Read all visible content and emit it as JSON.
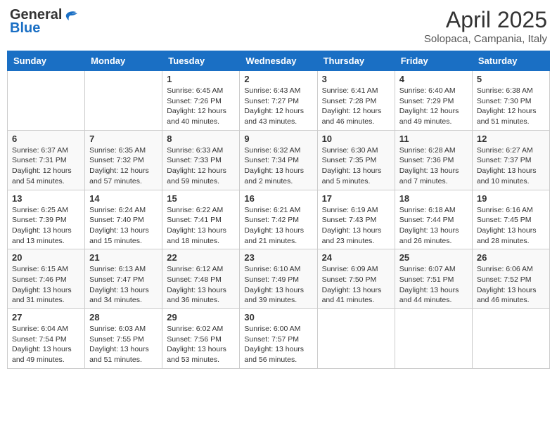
{
  "header": {
    "logo_general": "General",
    "logo_blue": "Blue",
    "title": "April 2025",
    "subtitle": "Solopaca, Campania, Italy"
  },
  "weekdays": [
    "Sunday",
    "Monday",
    "Tuesday",
    "Wednesday",
    "Thursday",
    "Friday",
    "Saturday"
  ],
  "weeks": [
    [
      {
        "day": "",
        "info": ""
      },
      {
        "day": "",
        "info": ""
      },
      {
        "day": "1",
        "info": "Sunrise: 6:45 AM\nSunset: 7:26 PM\nDaylight: 12 hours and 40 minutes."
      },
      {
        "day": "2",
        "info": "Sunrise: 6:43 AM\nSunset: 7:27 PM\nDaylight: 12 hours and 43 minutes."
      },
      {
        "day": "3",
        "info": "Sunrise: 6:41 AM\nSunset: 7:28 PM\nDaylight: 12 hours and 46 minutes."
      },
      {
        "day": "4",
        "info": "Sunrise: 6:40 AM\nSunset: 7:29 PM\nDaylight: 12 hours and 49 minutes."
      },
      {
        "day": "5",
        "info": "Sunrise: 6:38 AM\nSunset: 7:30 PM\nDaylight: 12 hours and 51 minutes."
      }
    ],
    [
      {
        "day": "6",
        "info": "Sunrise: 6:37 AM\nSunset: 7:31 PM\nDaylight: 12 hours and 54 minutes."
      },
      {
        "day": "7",
        "info": "Sunrise: 6:35 AM\nSunset: 7:32 PM\nDaylight: 12 hours and 57 minutes."
      },
      {
        "day": "8",
        "info": "Sunrise: 6:33 AM\nSunset: 7:33 PM\nDaylight: 12 hours and 59 minutes."
      },
      {
        "day": "9",
        "info": "Sunrise: 6:32 AM\nSunset: 7:34 PM\nDaylight: 13 hours and 2 minutes."
      },
      {
        "day": "10",
        "info": "Sunrise: 6:30 AM\nSunset: 7:35 PM\nDaylight: 13 hours and 5 minutes."
      },
      {
        "day": "11",
        "info": "Sunrise: 6:28 AM\nSunset: 7:36 PM\nDaylight: 13 hours and 7 minutes."
      },
      {
        "day": "12",
        "info": "Sunrise: 6:27 AM\nSunset: 7:37 PM\nDaylight: 13 hours and 10 minutes."
      }
    ],
    [
      {
        "day": "13",
        "info": "Sunrise: 6:25 AM\nSunset: 7:39 PM\nDaylight: 13 hours and 13 minutes."
      },
      {
        "day": "14",
        "info": "Sunrise: 6:24 AM\nSunset: 7:40 PM\nDaylight: 13 hours and 15 minutes."
      },
      {
        "day": "15",
        "info": "Sunrise: 6:22 AM\nSunset: 7:41 PM\nDaylight: 13 hours and 18 minutes."
      },
      {
        "day": "16",
        "info": "Sunrise: 6:21 AM\nSunset: 7:42 PM\nDaylight: 13 hours and 21 minutes."
      },
      {
        "day": "17",
        "info": "Sunrise: 6:19 AM\nSunset: 7:43 PM\nDaylight: 13 hours and 23 minutes."
      },
      {
        "day": "18",
        "info": "Sunrise: 6:18 AM\nSunset: 7:44 PM\nDaylight: 13 hours and 26 minutes."
      },
      {
        "day": "19",
        "info": "Sunrise: 6:16 AM\nSunset: 7:45 PM\nDaylight: 13 hours and 28 minutes."
      }
    ],
    [
      {
        "day": "20",
        "info": "Sunrise: 6:15 AM\nSunset: 7:46 PM\nDaylight: 13 hours and 31 minutes."
      },
      {
        "day": "21",
        "info": "Sunrise: 6:13 AM\nSunset: 7:47 PM\nDaylight: 13 hours and 34 minutes."
      },
      {
        "day": "22",
        "info": "Sunrise: 6:12 AM\nSunset: 7:48 PM\nDaylight: 13 hours and 36 minutes."
      },
      {
        "day": "23",
        "info": "Sunrise: 6:10 AM\nSunset: 7:49 PM\nDaylight: 13 hours and 39 minutes."
      },
      {
        "day": "24",
        "info": "Sunrise: 6:09 AM\nSunset: 7:50 PM\nDaylight: 13 hours and 41 minutes."
      },
      {
        "day": "25",
        "info": "Sunrise: 6:07 AM\nSunset: 7:51 PM\nDaylight: 13 hours and 44 minutes."
      },
      {
        "day": "26",
        "info": "Sunrise: 6:06 AM\nSunset: 7:52 PM\nDaylight: 13 hours and 46 minutes."
      }
    ],
    [
      {
        "day": "27",
        "info": "Sunrise: 6:04 AM\nSunset: 7:54 PM\nDaylight: 13 hours and 49 minutes."
      },
      {
        "day": "28",
        "info": "Sunrise: 6:03 AM\nSunset: 7:55 PM\nDaylight: 13 hours and 51 minutes."
      },
      {
        "day": "29",
        "info": "Sunrise: 6:02 AM\nSunset: 7:56 PM\nDaylight: 13 hours and 53 minutes."
      },
      {
        "day": "30",
        "info": "Sunrise: 6:00 AM\nSunset: 7:57 PM\nDaylight: 13 hours and 56 minutes."
      },
      {
        "day": "",
        "info": ""
      },
      {
        "day": "",
        "info": ""
      },
      {
        "day": "",
        "info": ""
      }
    ]
  ]
}
